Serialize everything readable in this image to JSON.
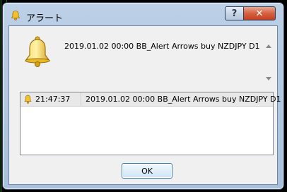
{
  "window": {
    "title": "アラート",
    "help_label": "?",
    "close_label": "✕"
  },
  "alert": {
    "message": "2019.01.02 00:00 BB_Alert Arrows buy NZDJPY D1",
    "icon": "bell-icon"
  },
  "history": [
    {
      "time": "21:47:37",
      "message": "2019.01.02 00:00 BB_Alert Arrows buy NZDJPY D1",
      "icon": "bell-icon"
    }
  ],
  "ok_label": "OK",
  "colors": {
    "chart_background": "#000000",
    "chart_grid": "#0f7a0f",
    "close_button": "#c24025",
    "bell": "#f2c228"
  }
}
